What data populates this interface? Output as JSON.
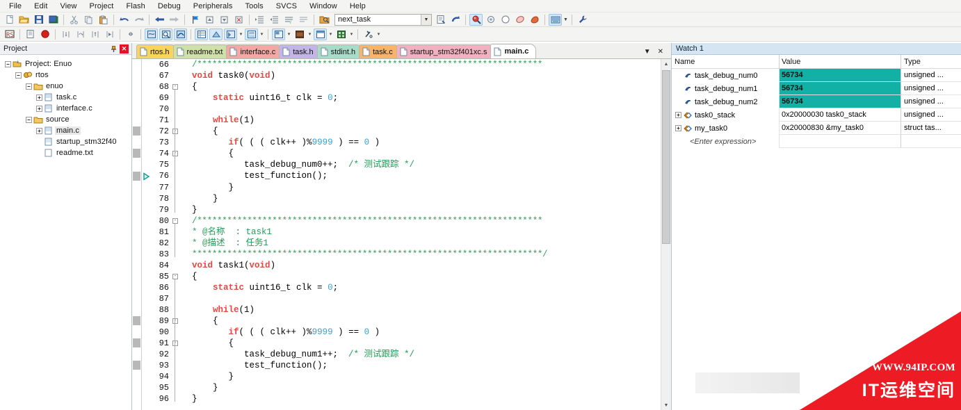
{
  "app": {
    "title": "Keil uVision",
    "accent": "#13b0a5",
    "watermark_red": "#ed1b24"
  },
  "menubar": {
    "items": [
      {
        "label": "File"
      },
      {
        "label": "Edit"
      },
      {
        "label": "View"
      },
      {
        "label": "Project"
      },
      {
        "label": "Flash"
      },
      {
        "label": "Debug"
      },
      {
        "label": "Peripherals"
      },
      {
        "label": "Tools"
      },
      {
        "label": "SVCS"
      },
      {
        "label": "Window"
      },
      {
        "label": "Help"
      }
    ]
  },
  "toolbar_main": {
    "combo_value": "next_task",
    "combo_placeholder": "next_task",
    "icons": [
      "new-file-icon",
      "open-file-icon",
      "save-icon",
      "save-all-icon",
      "cut-icon",
      "copy-icon",
      "paste-icon",
      "undo-icon",
      "redo-icon",
      "navigate-back-icon",
      "navigate-forward-icon",
      "bookmark-toggle-icon",
      "bookmark-prev-icon",
      "bookmark-next-icon",
      "bookmark-clear-icon",
      "indent-icon",
      "outdent-icon",
      "comment-icon",
      "uncomment-icon",
      "find-in-files-icon",
      "browse-symbol-icon",
      "goto-definition-icon",
      "find-icon",
      "target-options-icon",
      "build-icon",
      "rebuild-icon",
      "batch-build-icon",
      "manage-project-icon",
      "configure-wizard-icon"
    ]
  },
  "toolbar_debug": {
    "icons": [
      "reset-icon",
      "load-icon",
      "stop-debug-icon",
      "step-into-icon",
      "step-over-icon",
      "step-out-icon",
      "run-to-cursor-icon",
      "show-next-statement-icon",
      "command-window-icon",
      "disassembly-icon",
      "symbols-icon",
      "registers-icon",
      "call-stack-icon",
      "watch-window-icon",
      "memory-window-icon",
      "serial-window-icon",
      "analysis-window-icon",
      "trace-window-icon",
      "system-viewer-icon",
      "toolbox-icon"
    ]
  },
  "project_pane": {
    "title": "Project",
    "pin_icon": "pin-icon",
    "close_icon": "close-icon",
    "tree": [
      {
        "label": "Project: Enuo",
        "depth": 0,
        "icon": "project-icon",
        "expander": "-"
      },
      {
        "label": "rtos",
        "depth": 1,
        "icon": "target-icon",
        "expander": "-"
      },
      {
        "label": "enuo",
        "depth": 2,
        "icon": "folder-icon",
        "expander": "-"
      },
      {
        "label": "task.c",
        "depth": 3,
        "icon": "c-file-icon",
        "expander": "+"
      },
      {
        "label": "interface.c",
        "depth": 3,
        "icon": "c-file-icon",
        "expander": "+"
      },
      {
        "label": "source",
        "depth": 2,
        "icon": "folder-icon",
        "expander": "-"
      },
      {
        "label": "main.c",
        "depth": 3,
        "icon": "c-file-icon",
        "expander": "+",
        "selected": true
      },
      {
        "label": "startup_stm32f40",
        "depth": 3,
        "icon": "asm-file-icon",
        "expander": ""
      },
      {
        "label": "readme.txt",
        "depth": 3,
        "icon": "txt-file-icon",
        "expander": ""
      }
    ]
  },
  "editor": {
    "tabs": [
      {
        "label": "rtos.h",
        "color": "#fbd45c",
        "active": false
      },
      {
        "label": "readme.txt",
        "color": "#cfe0a8",
        "active": false
      },
      {
        "label": "interface.c",
        "color": "#f4a8a4",
        "active": false
      },
      {
        "label": "task.h",
        "color": "#c3b6e6",
        "active": false
      },
      {
        "label": "stdint.h",
        "color": "#a8dcc9",
        "active": false
      },
      {
        "label": "task.c",
        "color": "#f7b46a",
        "active": false
      },
      {
        "label": "startup_stm32f401xc.s",
        "color": "#f2b0c0",
        "active": false
      },
      {
        "label": "main.c",
        "color": "#ffffff",
        "active": true
      }
    ],
    "tab_menu_icon": "chevron-down-icon",
    "tab_close_icon": "close-icon",
    "first_line": 66,
    "lines": [
      {
        "n": 66,
        "fold": "",
        "html": "<span class=\"cmtg\">&nbsp;&nbsp;</span><span class=\"star\">/*********************************************************************</span>"
      },
      {
        "n": 67,
        "fold": "",
        "html": "&nbsp;&nbsp;<span class=\"kw\">void</span> task0(<span class=\"kw\">void</span>)"
      },
      {
        "n": 68,
        "fold": "-",
        "html": "&nbsp;&nbsp;{"
      },
      {
        "n": 69,
        "fold": "",
        "html": "&nbsp;&nbsp;&nbsp;&nbsp;&nbsp;&nbsp;<span class=\"kw\">static</span> uint16_t clk = <span class=\"num\">0</span>;"
      },
      {
        "n": 70,
        "fold": "",
        "html": ""
      },
      {
        "n": 71,
        "fold": "",
        "html": "&nbsp;&nbsp;&nbsp;&nbsp;&nbsp;&nbsp;<span class=\"kw\">while</span>(1)"
      },
      {
        "n": 72,
        "fold": "-",
        "html": "&nbsp;&nbsp;&nbsp;&nbsp;&nbsp;&nbsp;{"
      },
      {
        "n": 73,
        "fold": "",
        "html": "&nbsp;&nbsp;&nbsp;&nbsp;&nbsp;&nbsp;&nbsp;&nbsp;&nbsp;<span class=\"kw\">if</span>( ( ( clk++ )%<span class=\"num\">9999</span> ) == <span class=\"num\">0</span> )"
      },
      {
        "n": 74,
        "fold": "-",
        "html": "&nbsp;&nbsp;&nbsp;&nbsp;&nbsp;&nbsp;&nbsp;&nbsp;&nbsp;{"
      },
      {
        "n": 75,
        "fold": "",
        "html": "&nbsp;&nbsp;&nbsp;&nbsp;&nbsp;&nbsp;&nbsp;&nbsp;&nbsp;&nbsp;&nbsp;&nbsp;task_debug_num0++;&nbsp;&nbsp;<span class=\"cmt\">/* 测试跟踪 */</span>"
      },
      {
        "n": 76,
        "fold": "",
        "html": "&nbsp;&nbsp;&nbsp;&nbsp;&nbsp;&nbsp;&nbsp;&nbsp;&nbsp;&nbsp;&nbsp;&nbsp;test_function();"
      },
      {
        "n": 77,
        "fold": "",
        "html": "&nbsp;&nbsp;&nbsp;&nbsp;&nbsp;&nbsp;&nbsp;&nbsp;&nbsp;}"
      },
      {
        "n": 78,
        "fold": "",
        "html": "&nbsp;&nbsp;&nbsp;&nbsp;&nbsp;&nbsp;}"
      },
      {
        "n": 79,
        "fold": "",
        "html": "&nbsp;&nbsp;}"
      },
      {
        "n": 80,
        "fold": "-",
        "html": "&nbsp;&nbsp;<span class=\"star\">/*********************************************************************</span>"
      },
      {
        "n": 81,
        "fold": "",
        "html": "&nbsp;&nbsp;<span class=\"cmtg\">* @</span><span class=\"cmt\">名称&nbsp;&nbsp;: task1</span>"
      },
      {
        "n": 82,
        "fold": "",
        "html": "&nbsp;&nbsp;<span class=\"cmtg\">* @</span><span class=\"cmt\">描述&nbsp;&nbsp;: 任务1</span>"
      },
      {
        "n": 83,
        "fold": "",
        "html": "&nbsp;&nbsp;<span class=\"star\">**********************************************************************/</span>"
      },
      {
        "n": 84,
        "fold": "",
        "html": "&nbsp;&nbsp;<span class=\"kw\">void</span> task1(<span class=\"kw\">void</span>)"
      },
      {
        "n": 85,
        "fold": "-",
        "html": "&nbsp;&nbsp;{"
      },
      {
        "n": 86,
        "fold": "",
        "html": "&nbsp;&nbsp;&nbsp;&nbsp;&nbsp;&nbsp;<span class=\"kw\">static</span> uint16_t clk = <span class=\"num\">0</span>;"
      },
      {
        "n": 87,
        "fold": "",
        "html": ""
      },
      {
        "n": 88,
        "fold": "",
        "html": "&nbsp;&nbsp;&nbsp;&nbsp;&nbsp;&nbsp;<span class=\"kw\">while</span>(1)"
      },
      {
        "n": 89,
        "fold": "-",
        "html": "&nbsp;&nbsp;&nbsp;&nbsp;&nbsp;&nbsp;{"
      },
      {
        "n": 90,
        "fold": "",
        "html": "&nbsp;&nbsp;&nbsp;&nbsp;&nbsp;&nbsp;&nbsp;&nbsp;&nbsp;<span class=\"kw\">if</span>( ( ( clk++ )%<span class=\"num\">9999</span> ) == <span class=\"num\">0</span> )"
      },
      {
        "n": 91,
        "fold": "-",
        "html": "&nbsp;&nbsp;&nbsp;&nbsp;&nbsp;&nbsp;&nbsp;&nbsp;&nbsp;{"
      },
      {
        "n": 92,
        "fold": "",
        "html": "&nbsp;&nbsp;&nbsp;&nbsp;&nbsp;&nbsp;&nbsp;&nbsp;&nbsp;&nbsp;&nbsp;&nbsp;task_debug_num1++;&nbsp;&nbsp;<span class=\"cmt\">/* 测试跟踪 */</span>"
      },
      {
        "n": 93,
        "fold": "",
        "html": "&nbsp;&nbsp;&nbsp;&nbsp;&nbsp;&nbsp;&nbsp;&nbsp;&nbsp;&nbsp;&nbsp;&nbsp;test_function();"
      },
      {
        "n": 94,
        "fold": "",
        "html": "&nbsp;&nbsp;&nbsp;&nbsp;&nbsp;&nbsp;&nbsp;&nbsp;&nbsp;}"
      },
      {
        "n": 95,
        "fold": "",
        "html": "&nbsp;&nbsp;&nbsp;&nbsp;&nbsp;&nbsp;}"
      },
      {
        "n": 96,
        "fold": "",
        "html": "&nbsp;&nbsp;}"
      }
    ],
    "coverage_lines": [
      72,
      74,
      76,
      89,
      91,
      93
    ],
    "current_statement_line": 76,
    "current_statement_icon": "execution-pointer-icon"
  },
  "watch_pane": {
    "title": "Watch 1",
    "columns": [
      "Name",
      "Value",
      "Type"
    ],
    "rows": [
      {
        "expander": "",
        "icon": "variable-icon",
        "name": "task_debug_num0",
        "value": "56734",
        "type": "unsigned ...",
        "changed": true
      },
      {
        "expander": "",
        "icon": "variable-icon",
        "name": "task_debug_num1",
        "value": "56734",
        "type": "unsigned ...",
        "changed": true
      },
      {
        "expander": "",
        "icon": "variable-icon",
        "name": "task_debug_num2",
        "value": "56734",
        "type": "unsigned ...",
        "changed": true
      },
      {
        "expander": "+",
        "icon": "array-icon",
        "name": "task0_stack",
        "value": "0x20000030 task0_stack",
        "type": "unsigned ...",
        "changed": false
      },
      {
        "expander": "+",
        "icon": "struct-icon",
        "name": "my_task0",
        "value": "0x20000830 &my_task0",
        "type": "struct tas...",
        "changed": false
      }
    ],
    "entry_row": "<Enter expression>"
  },
  "watermark": {
    "url": "WWW.94IP.COM",
    "name": "IT运维空间"
  }
}
